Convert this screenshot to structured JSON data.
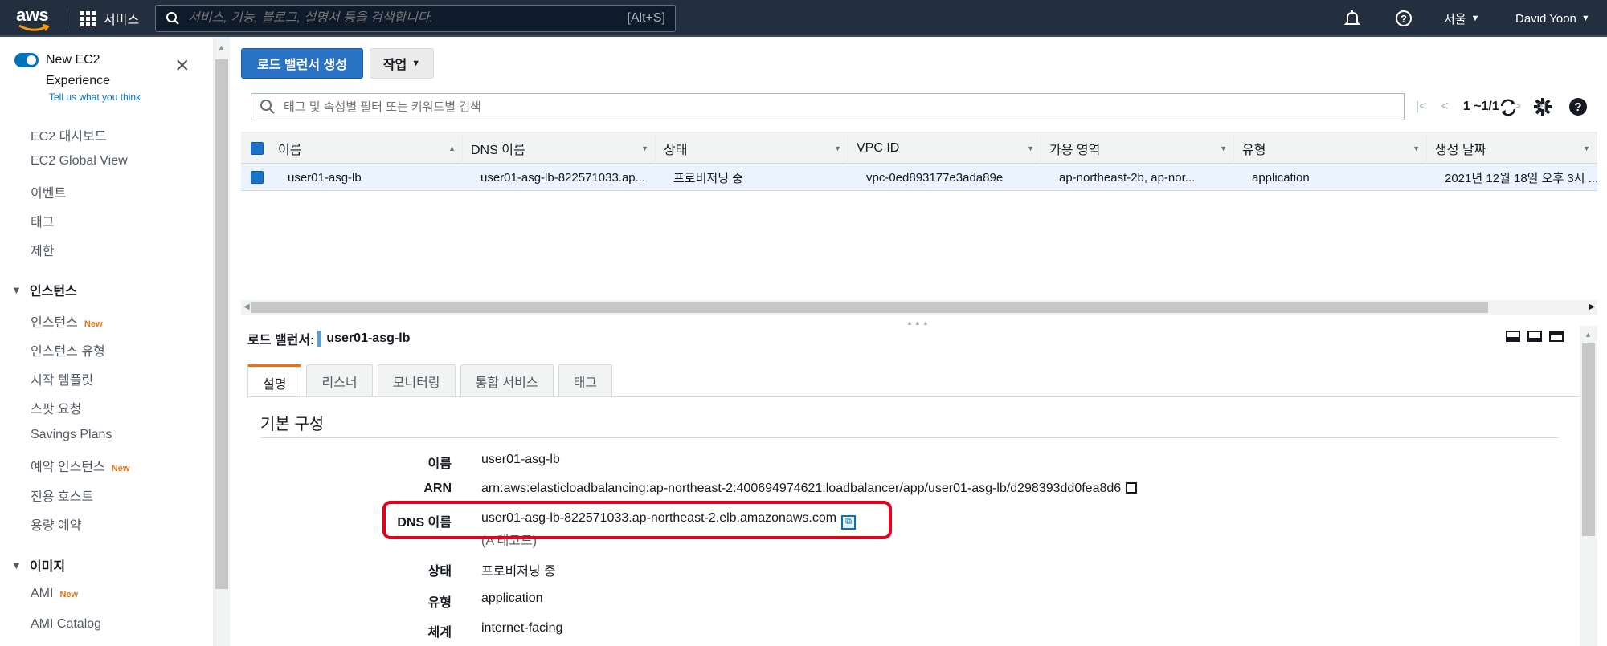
{
  "topnav": {
    "logo_text": "aws",
    "services_label": "서비스",
    "search_placeholder": "서비스, 기능, 블로그, 설명서 등을 검색합니다.",
    "search_shortcut": "[Alt+S]",
    "region": "서울",
    "user": "David Yoon",
    "icons": [
      "bell-icon",
      "help-icon"
    ]
  },
  "sidebar": {
    "toggle_label": "New EC2 Experience",
    "tell_us": "Tell us what you think",
    "items_top": [
      "EC2 대시보드",
      "EC2 Global View",
      "이벤트",
      "태그",
      "제한"
    ],
    "section_instances": "인스턴스",
    "instances": [
      {
        "label": "인스턴스",
        "badge": "New"
      },
      {
        "label": "인스턴스 유형",
        "badge": ""
      },
      {
        "label": "시작 템플릿",
        "badge": ""
      },
      {
        "label": "스팟 요청",
        "badge": ""
      },
      {
        "label": "Savings Plans",
        "badge": ""
      },
      {
        "label": "예약 인스턴스",
        "badge": "New"
      },
      {
        "label": "전용 호스트",
        "badge": ""
      },
      {
        "label": "용량 예약",
        "badge": ""
      }
    ],
    "section_images": "이미지",
    "images": [
      {
        "label": "AMI",
        "badge": "New"
      },
      {
        "label": "AMI Catalog",
        "badge": ""
      }
    ]
  },
  "toolbar": {
    "create_button": "로드 밸런서 생성",
    "actions_button": "작업"
  },
  "filter": {
    "placeholder": "태그 및 속성별 필터 또는 키워드별 검색",
    "page_range": "1 ~1/1"
  },
  "table": {
    "columns": [
      "이름",
      "DNS 이름",
      "상태",
      "VPC ID",
      "가용 영역",
      "유형",
      "생성 날짜"
    ],
    "rows": [
      [
        "user01-asg-lb",
        "user01-asg-lb-822571033.ap...",
        "프로비저닝 중",
        "vpc-0ed893177e3ada89e",
        "ap-northeast-2b, ap-nor...",
        "application",
        "2021년 12월 18일 오후 3시 ..."
      ]
    ]
  },
  "detail": {
    "title_label": "로드 밸런서:",
    "title_value": "user01-asg-lb",
    "tabs": [
      "설명",
      "리스너",
      "모니터링",
      "통합 서비스",
      "태그"
    ],
    "active_tab": "설명",
    "section_title": "기본 구성",
    "fields": {
      "name_label": "이름",
      "name_value": "user01-asg-lb",
      "arn_label": "ARN",
      "arn_value": "arn:aws:elasticloadbalancing:ap-northeast-2:400694974621:loadbalancer/app/user01-asg-lb/d298393dd0fea8d6",
      "dns_label": "DNS 이름",
      "dns_value": "user01-asg-lb-822571033.ap-northeast-2.elb.amazonaws.com",
      "dns_note": "(A 레코드)",
      "state_label": "상태",
      "state_value": "프로비저닝 중",
      "type_label": "유형",
      "type_value": "application",
      "scheme_label": "체계",
      "scheme_value": "internet-facing"
    }
  },
  "colors": {
    "nav_bg": "#232f3e",
    "primary": "#2a72c3",
    "accent": "#ec7211",
    "highlight": "#e3001b"
  }
}
